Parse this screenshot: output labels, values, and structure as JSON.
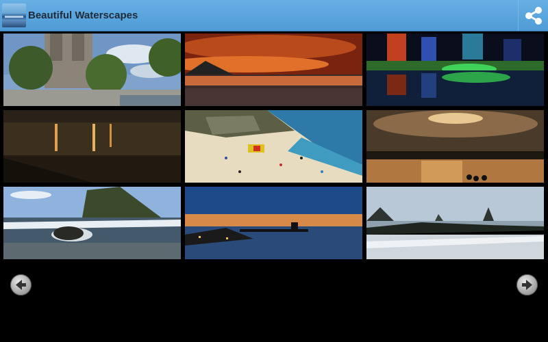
{
  "app": {
    "title": "Beautiful Waterscapes",
    "icon": "waterscape-app-icon",
    "bar_color": "#5fa8de"
  },
  "actions": {
    "share_icon": "share-icon"
  },
  "gallery": {
    "tiles": [
      {
        "id": "notre-dame-river"
      },
      {
        "id": "red-sunset-sea"
      },
      {
        "id": "city-lights-reflection"
      },
      {
        "id": "night-lake-lights"
      },
      {
        "id": "crowded-beach"
      },
      {
        "id": "sunset-lake-silhouettes"
      },
      {
        "id": "rocky-coast"
      },
      {
        "id": "pier-at-dusk"
      },
      {
        "id": "sea-stacks-beach"
      }
    ]
  },
  "navigation": {
    "prev_icon": "arrow-left-icon",
    "next_icon": "arrow-right-icon"
  }
}
